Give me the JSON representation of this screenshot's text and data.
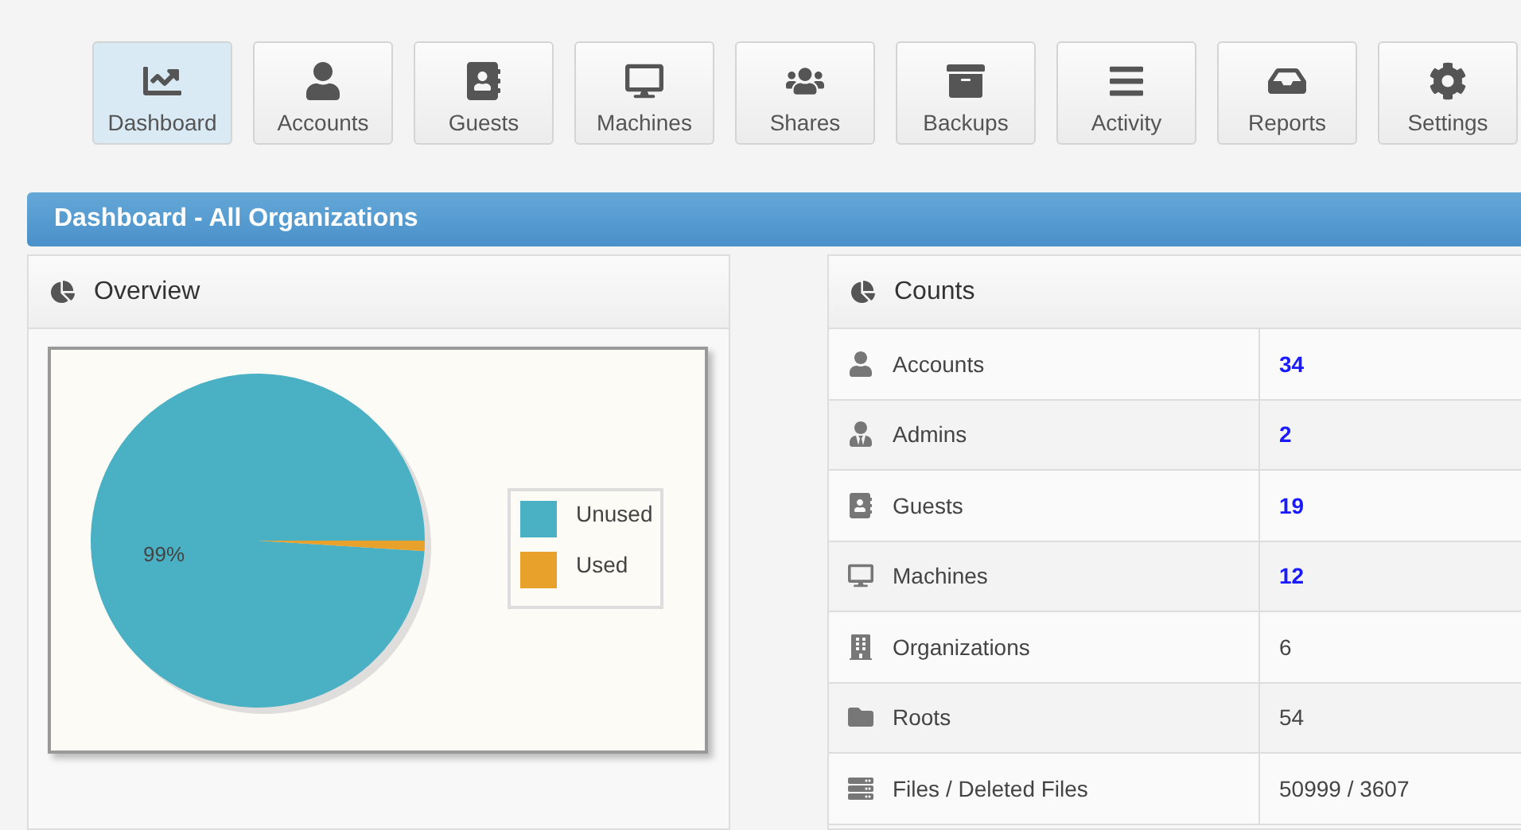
{
  "nav": [
    {
      "label": "Dashboard",
      "selected": true
    },
    {
      "label": "Accounts",
      "selected": false
    },
    {
      "label": "Guests",
      "selected": false
    },
    {
      "label": "Machines",
      "selected": false
    },
    {
      "label": "Shares",
      "selected": false
    },
    {
      "label": "Backups",
      "selected": false
    },
    {
      "label": "Activity",
      "selected": false
    },
    {
      "label": "Reports",
      "selected": false
    },
    {
      "label": "Settings",
      "selected": false
    }
  ],
  "page_title": "Dashboard - All Organizations",
  "overview": {
    "title": "Overview",
    "chart_data": {
      "type": "pie",
      "categories": [
        "Unused",
        "Used"
      ],
      "values": [
        99,
        1
      ],
      "legend": "right",
      "colors": [
        "#4ab0c4",
        "#e8a12a"
      ],
      "value_labels": [
        "99%",
        null
      ]
    }
  },
  "counts": {
    "title": "Counts",
    "rows": [
      {
        "label": "Accounts",
        "value": "34",
        "kind": "link"
      },
      {
        "label": "Admins",
        "value": "2",
        "kind": "link"
      },
      {
        "label": "Guests",
        "value": "19",
        "kind": "link"
      },
      {
        "label": "Machines",
        "value": "12",
        "kind": "link"
      },
      {
        "label": "Organizations",
        "value": "6",
        "kind": "text"
      },
      {
        "label": "Roots",
        "value": "54",
        "kind": "text"
      },
      {
        "label": "Files / Deleted Files",
        "value": "50999 / 3607",
        "kind": "text"
      }
    ]
  }
}
